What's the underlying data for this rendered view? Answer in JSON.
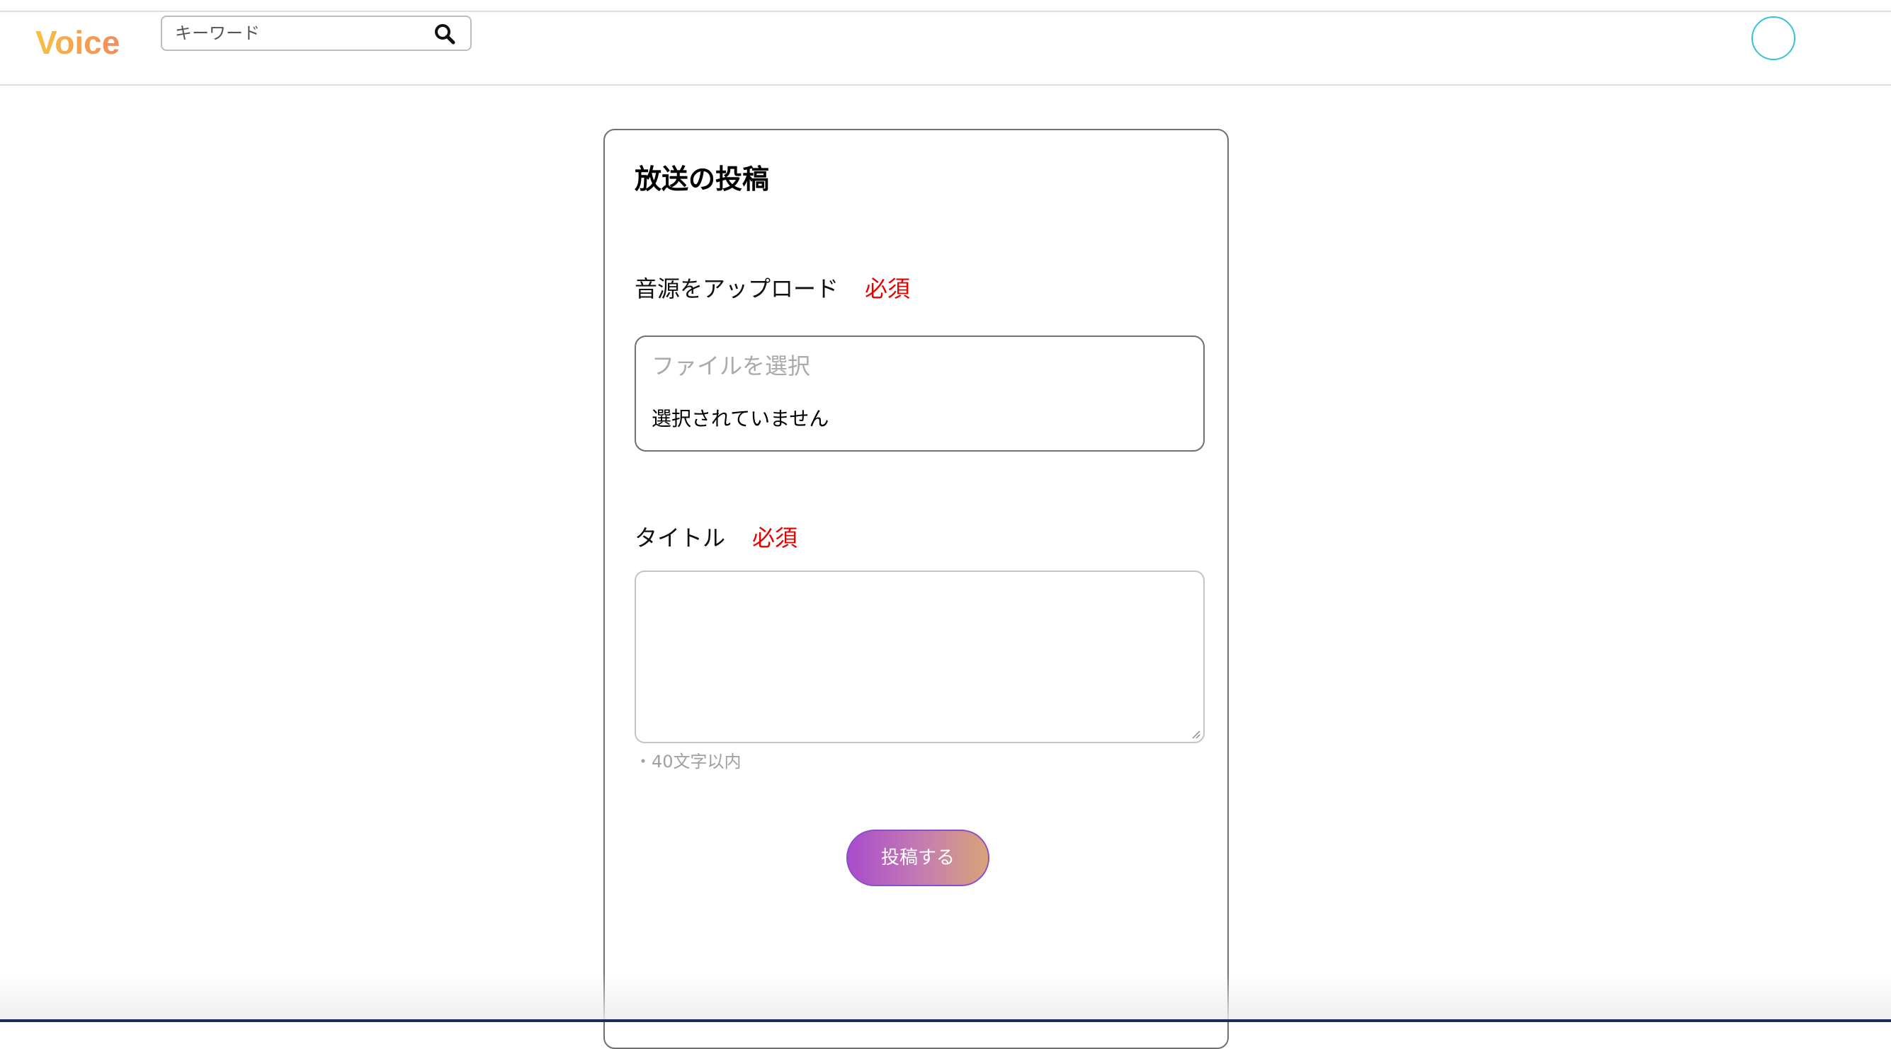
{
  "header": {
    "logo_text": "Voice",
    "search": {
      "placeholder": "キーワード",
      "value": ""
    },
    "avatar_icon": "avatar-circle"
  },
  "form": {
    "title": "放送の投稿",
    "audio_upload": {
      "label": "音源をアップロード",
      "required_label": "必須",
      "choose_file_text": "ファイルを選択",
      "no_file_text": "選択されていません"
    },
    "title_field": {
      "label": "タイトル",
      "required_label": "必須",
      "value": "",
      "hint": "・40文字以内"
    },
    "submit_label": "投稿する"
  },
  "colors": {
    "accent_required": "#e60000",
    "avatar_border": "#35c4d6",
    "button_gradient_start": "#a94ccb",
    "button_gradient_end": "#d8a379",
    "logo_gradient_start": "#f6c247",
    "logo_gradient_end": "#ef8e62"
  }
}
